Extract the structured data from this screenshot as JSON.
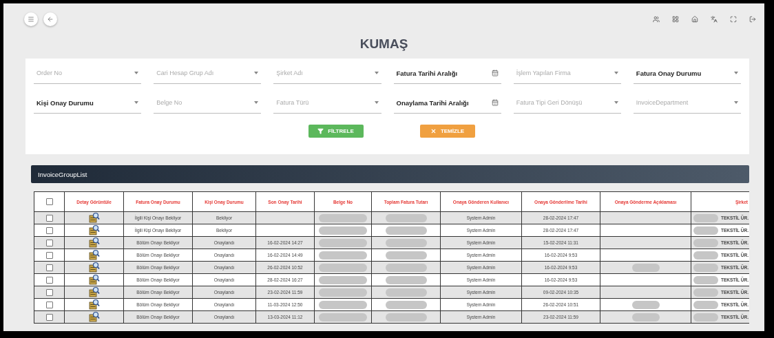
{
  "page": {
    "title": "KUMAŞ"
  },
  "filters": [
    {
      "kind": "select",
      "placeholder": "Order No"
    },
    {
      "kind": "select",
      "placeholder": "Cari Hesap Grup Adı"
    },
    {
      "kind": "select",
      "placeholder": "Şirket Adı"
    },
    {
      "kind": "date",
      "label": "Fatura Tarihi Aralığı"
    },
    {
      "kind": "select",
      "placeholder": "İşlem Yapılan Firma"
    },
    {
      "kind": "select",
      "label": "Fatura Onay Durumu"
    },
    {
      "kind": "select",
      "label": "Kişi Onay Durumu"
    },
    {
      "kind": "select",
      "placeholder": "Belge No"
    },
    {
      "kind": "select",
      "placeholder": "Fatura Türü"
    },
    {
      "kind": "date",
      "label": "Onaylama Tarihi Aralığı"
    },
    {
      "kind": "select",
      "placeholder": "Fatura Tipi Geri Dönüşü"
    },
    {
      "kind": "select",
      "placeholder": "InvoiceDepartment"
    }
  ],
  "buttons": [
    {
      "kind": "filter",
      "label": "FİLTRELE"
    },
    {
      "kind": "clear",
      "label": "TEMİZLE"
    }
  ],
  "table": {
    "title": "InvoiceGroupList",
    "select_all": {
      "checked": false
    },
    "columns": [
      "Detay Görüntüle",
      "Fatura Onay Durumu",
      "Kişi Onay Durumu",
      "Son Onay Tarihi",
      "Belge No",
      "Toplam Fatura Tutarı",
      "Onaya Gönderen Kullanıcı",
      "Onaya Gönderilme Tarihi",
      "Onaya Gönderme Açıklaması",
      "Şirket"
    ],
    "rows": [
      {
        "checked": false,
        "fatura_onay": "İlgili Kişi Onayı Bekliyor",
        "kisi_onay": "Bekliyor",
        "son_onay": "",
        "gonderen": "System Admin",
        "gonderilme": "28-02-2024 17:47",
        "aciklama_blurred": false,
        "sirket": "TEKSTİL ÜR."
      },
      {
        "checked": false,
        "fatura_onay": "İlgili Kişi Onayı Bekliyor",
        "kisi_onay": "Bekliyor",
        "son_onay": "",
        "gonderen": "System Admin",
        "gonderilme": "28-02-2024 17:47",
        "aciklama_blurred": false,
        "sirket": "TEKSTİL ÜR."
      },
      {
        "checked": false,
        "fatura_onay": "Bölüm Onayı Bekliyor",
        "kisi_onay": "Onaylandı",
        "son_onay": "16-02-2024 14:27",
        "gonderen": "System Admin",
        "gonderilme": "15-02-2024 11:31",
        "aciklama_blurred": false,
        "sirket": "TEKSTİL ÜR."
      },
      {
        "checked": false,
        "fatura_onay": "Bölüm Onayı Bekliyor",
        "kisi_onay": "Onaylandı",
        "son_onay": "16-02-2024 14:49",
        "gonderen": "System Admin",
        "gonderilme": "16-02-2024 9:53",
        "aciklama_blurred": false,
        "sirket": "TEKSTİL ÜR."
      },
      {
        "checked": false,
        "fatura_onay": "Bölüm Onayı Bekliyor",
        "kisi_onay": "Onaylandı",
        "son_onay": "26-02-2024 10:52",
        "gonderen": "System Admin",
        "gonderilme": "16-02-2024 9:53",
        "aciklama_blurred": true,
        "sirket": "TEKSTİL ÜR."
      },
      {
        "checked": false,
        "fatura_onay": "Bölüm Onayı Bekliyor",
        "kisi_onay": "Onaylandı",
        "son_onay": "28-02-2024 16:27",
        "gonderen": "System Admin",
        "gonderilme": "16-02-2024 9:53",
        "aciklama_blurred": false,
        "sirket": "TEKSTİL ÜR."
      },
      {
        "checked": false,
        "fatura_onay": "Bölüm Onayı Bekliyor",
        "kisi_onay": "Onaylandı",
        "son_onay": "23-02-2024 11:59",
        "gonderen": "System Admin",
        "gonderilme": "09-02-2024 10:35",
        "aciklama_blurred": false,
        "sirket": "TEKSTİL ÜR."
      },
      {
        "checked": false,
        "fatura_onay": "Bölüm Onayı Bekliyor",
        "kisi_onay": "Onaylandı",
        "son_onay": "11-03-2024 12:50",
        "gonderen": "System Admin",
        "gonderilme": "26-02-2024 10:51",
        "aciklama_blurred": true,
        "sirket": "TEKSTİL ÜR."
      },
      {
        "checked": false,
        "fatura_onay": "Bölüm Onayı Bekliyor",
        "kisi_onay": "Onaylandı",
        "son_onay": "13-03-2024 11:12",
        "gonderen": "System Admin",
        "gonderilme": "23-02-2024 11:59",
        "aciklama_blurred": true,
        "sirket": "TEKSTİL ÜR."
      }
    ]
  }
}
